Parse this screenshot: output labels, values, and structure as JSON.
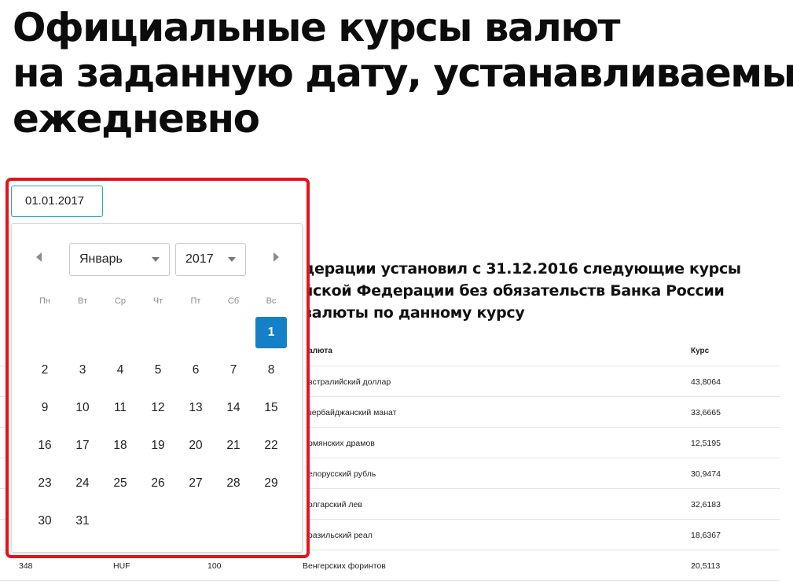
{
  "header": {
    "title_lines": [
      "Официальные курсы валют",
      "на заданную дату, устанавливаемые",
      "ежедневно"
    ]
  },
  "description": {
    "lines": [
      "дерации установил с 31.12.2016 следующие курсы",
      "йской Федерации без обязательств Банка России",
      "валюты по данному курсу"
    ]
  },
  "date_picker": {
    "input_value": "01.01.2017",
    "month_selected": "Январь",
    "year_selected": "2017",
    "weekdays": [
      "Пн",
      "Вт",
      "Ср",
      "Чт",
      "Пт",
      "Сб",
      "Вс"
    ],
    "weeks": [
      [
        "",
        "",
        "",
        "",
        "",
        "",
        "1"
      ],
      [
        "2",
        "3",
        "4",
        "5",
        "6",
        "7",
        "8"
      ],
      [
        "9",
        "10",
        "11",
        "12",
        "13",
        "14",
        "15"
      ],
      [
        "16",
        "17",
        "18",
        "19",
        "20",
        "21",
        "22"
      ],
      [
        "23",
        "24",
        "25",
        "26",
        "27",
        "28",
        "29"
      ],
      [
        "30",
        "31",
        "",
        "",
        "",
        "",
        ""
      ]
    ],
    "selected_day": "1",
    "selected_color": "#1480c8",
    "highlight_color": "#e4131b",
    "input_border_color": "#22a6d2"
  },
  "table": {
    "headers": {
      "name": "Валюта",
      "rate": "Курс"
    },
    "rows": [
      {
        "code": "",
        "letter": "",
        "unit": "",
        "name": "Австралийский доллар",
        "rate": "43,8064"
      },
      {
        "code": "",
        "letter": "",
        "unit": "",
        "name": "Азербайджанский манат",
        "rate": "33,6665"
      },
      {
        "code": "",
        "letter": "",
        "unit": "",
        "name": "Армянских драмов",
        "rate": "12,5195"
      },
      {
        "code": "",
        "letter": "",
        "unit": "",
        "name": "Белорусский рубль",
        "rate": "30,9474"
      },
      {
        "code": "",
        "letter": "",
        "unit": "",
        "name": "Болгарский лев",
        "rate": "32,6183"
      },
      {
        "code": "",
        "letter": "",
        "unit": "",
        "name": "Бразильский реал",
        "rate": "18,6367"
      },
      {
        "code": "348",
        "letter": "HUF",
        "unit": "100",
        "name": "Венгерских форинтов",
        "rate": "20,5113"
      }
    ]
  }
}
